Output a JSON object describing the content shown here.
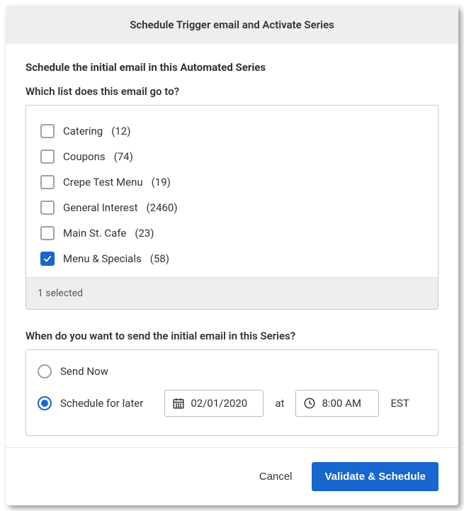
{
  "header": {
    "title": "Schedule Trigger email and Activate Series"
  },
  "body": {
    "sectionTitle": "Schedule the initial email in this Automated Series",
    "listQuestion": "Which list does this email go to?",
    "lists": [
      {
        "name": "Catering",
        "count": "(12)",
        "checked": false
      },
      {
        "name": "Coupons",
        "count": "(74)",
        "checked": false
      },
      {
        "name": "Crepe Test Menu",
        "count": "(19)",
        "checked": false
      },
      {
        "name": "General Interest",
        "count": "(2460)",
        "checked": false
      },
      {
        "name": "Main St. Cafe",
        "count": "(23)",
        "checked": false
      },
      {
        "name": "Menu & Specials",
        "count": "(58)",
        "checked": true
      }
    ],
    "listFooter": "1 selected",
    "sendQuestion": "When do you want to send the initial email in this Series?",
    "sendOptions": {
      "now": {
        "label": "Send Now",
        "selected": false
      },
      "later": {
        "label": "Schedule for later",
        "selected": true
      }
    },
    "schedule": {
      "date": "02/01/2020",
      "atLabel": "at",
      "time": "8:00 AM",
      "timezone": "EST"
    }
  },
  "footer": {
    "cancel": "Cancel",
    "submit": "Validate & Schedule"
  }
}
